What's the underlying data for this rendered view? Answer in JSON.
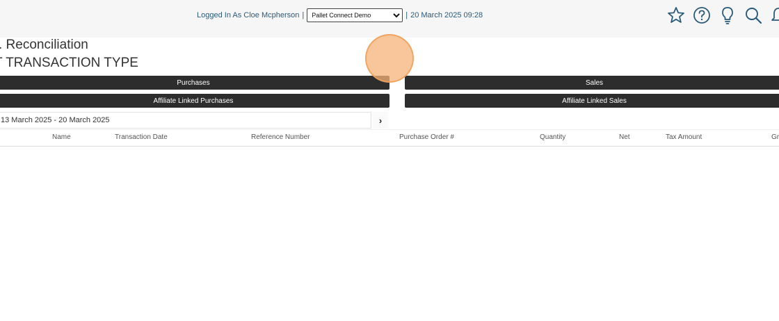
{
  "header": {
    "logged_in_text": "Logged In As Cloe Mcpherson",
    "separator": "|",
    "company_select": {
      "selected": "Pallet Connect Demo"
    },
    "datetime": "20 March 2025 09:28",
    "icons": [
      "star-icon",
      "help-circle-icon",
      "lightbulb-icon",
      "search-icon",
      "bell-icon"
    ]
  },
  "page": {
    "title": ". Reconciliation",
    "subtitle": "T TRANSACTION TYPE"
  },
  "type_buttons": {
    "purchases": "Purchases",
    "sales": "Sales",
    "affiliate_purchases": "Affiliate Linked Purchases",
    "affiliate_sales": "Affiliate Linked Sales"
  },
  "date_filter": {
    "range": "13 March 2025 - 20 March 2025",
    "next": "›"
  },
  "table": {
    "columns": [
      "Name",
      "Transaction Date",
      "Reference Number",
      "Purchase Order #",
      "Quantity",
      "Net",
      "Tax Amount",
      "Gr"
    ]
  }
}
